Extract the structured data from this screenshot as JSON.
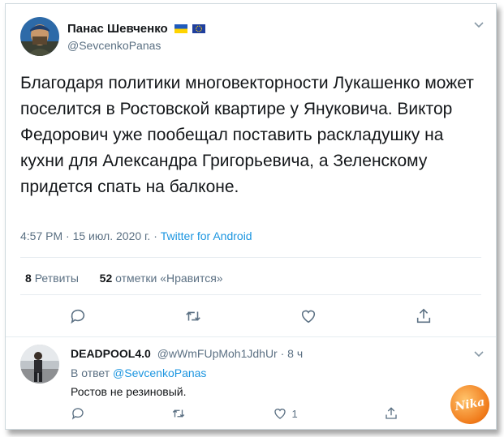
{
  "tweet": {
    "author_name": "Панас Шевченко",
    "handle": "@SevcenkoPanas",
    "text": "Благодаря политики многовекторности Лукашенко может поселится в Ростовской квартире у Януковича. Виктор Федорович уже пообещал поставить раскладушку на кухни для Александра Григорьевича, а Зеленскому придется спать на балконе.",
    "time": "4:57 PM · 15 июл. 2020 г. · ",
    "source": "Twitter for Android",
    "retweets_count": "8",
    "retweets_label": "Ретвиты",
    "likes_count": "52",
    "likes_label": "отметки «Нравится»"
  },
  "reply": {
    "author_name": "DEADPOOL4.0",
    "handle_time": "@wWmFUpMoh1JdhUr · 8 ч",
    "reply_prefix": "В ответ ",
    "reply_handle": "@SevcenkoPanas",
    "text": "Ростов не резиновый.",
    "like_count": "1"
  },
  "watermark": "Nika",
  "icons": [
    "ukraine-flag-icon",
    "eu-flag-icon",
    "chevron-down-icon",
    "reply-icon",
    "retweet-icon",
    "like-icon",
    "share-icon"
  ]
}
